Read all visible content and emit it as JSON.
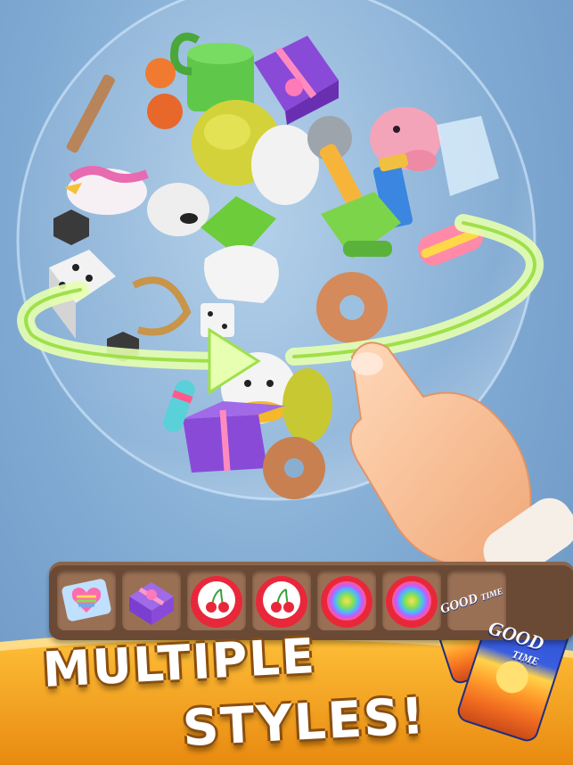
{
  "banner": {
    "line1": "MULTIPLE",
    "line2": "STYLES!"
  },
  "cans": {
    "text1": "GOOD",
    "text2": "TIME"
  },
  "tray": {
    "slots": [
      "candy-heart",
      "gift-box",
      "cherry-button",
      "cherry-button",
      "rainbow-button",
      "rainbow-button",
      "empty",
      "empty"
    ]
  },
  "colors": {
    "background": "#7fa9d2",
    "banner": "#f0a020",
    "swipe_arrow": "#d8ff8a",
    "tray": "#6b4a35"
  }
}
